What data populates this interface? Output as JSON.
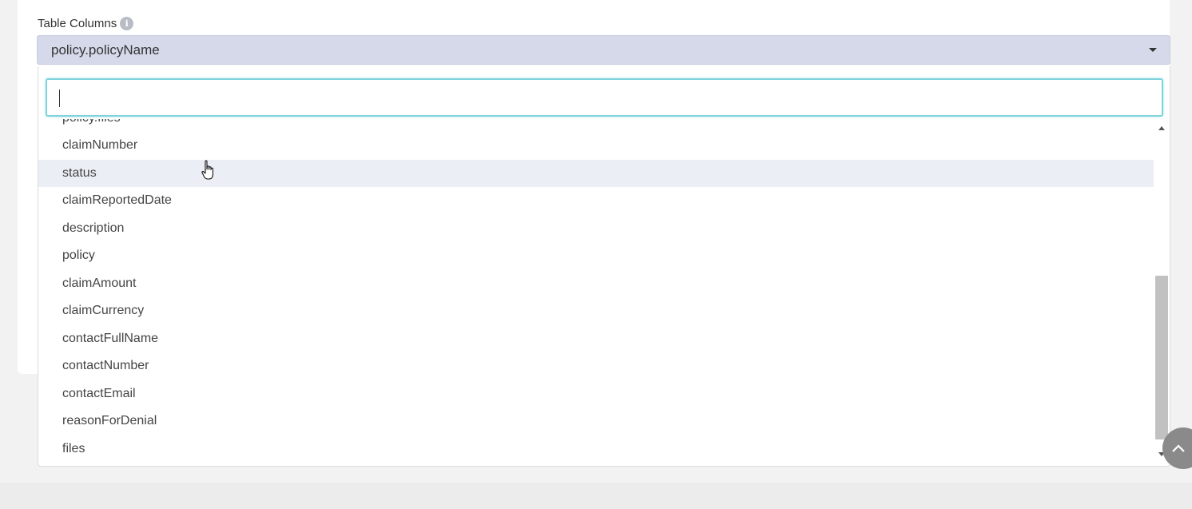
{
  "field": {
    "label": "Table Columns",
    "info_icon": "info-icon",
    "selected_value": "policy.policyName"
  },
  "dropdown": {
    "search_value": "",
    "partially_visible_option": "policy.files",
    "hovered_option": "status",
    "options": [
      "claimNumber",
      "status",
      "claimReportedDate",
      "description",
      "policy",
      "claimAmount",
      "claimCurrency",
      "contactFullName",
      "contactNumber",
      "contactEmail",
      "reasonForDenial",
      "files"
    ]
  },
  "colors": {
    "select_bg": "#d6d9ea",
    "search_focus_border": "#7fd3dc",
    "hover_bg": "#eceef6"
  }
}
